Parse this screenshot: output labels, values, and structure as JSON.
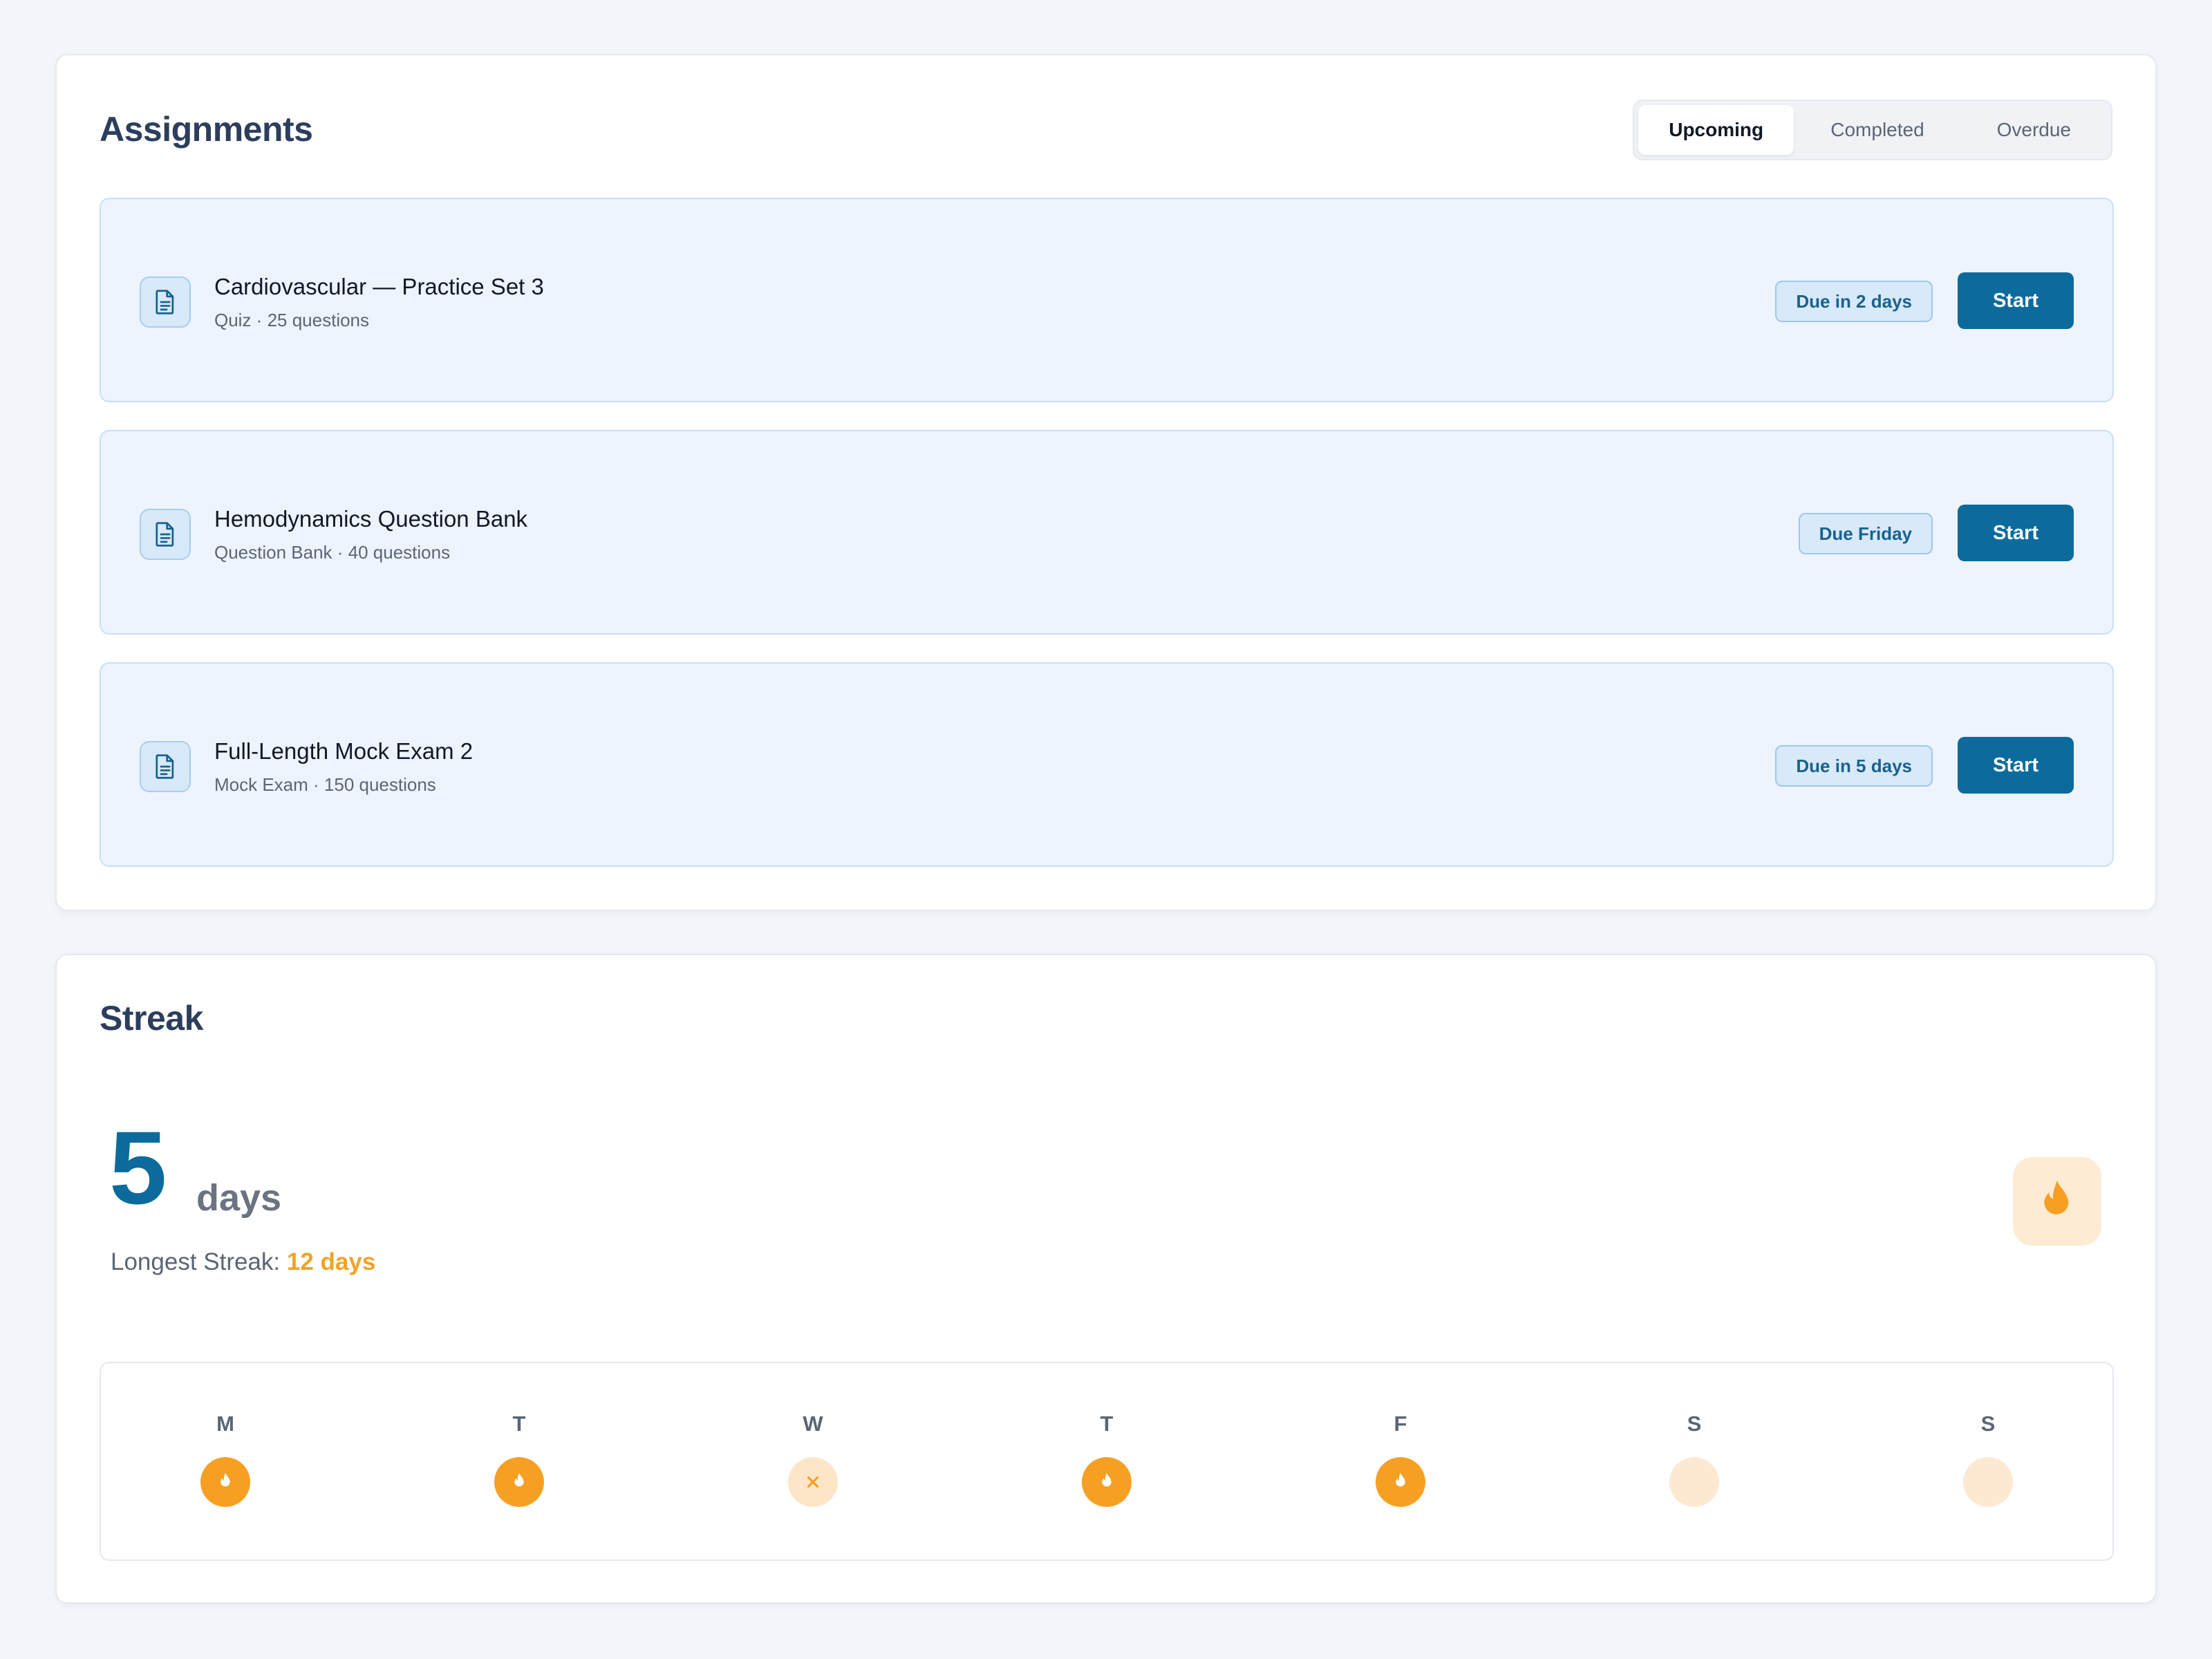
{
  "assignments": {
    "title": "Assignments",
    "tabs": [
      {
        "label": "Upcoming",
        "active": true
      },
      {
        "label": "Completed",
        "active": false
      },
      {
        "label": "Overdue",
        "active": false
      }
    ],
    "items": [
      {
        "title": "Cardiovascular — Practice Set 3",
        "subtitle": "Quiz · 25 questions",
        "due": "Due in 2 days",
        "action": "Start",
        "icon": "document-icon"
      },
      {
        "title": "Hemodynamics Question Bank",
        "subtitle": "Question Bank · 40 questions",
        "due": "Due Friday",
        "action": "Start",
        "icon": "document-icon"
      },
      {
        "title": "Full-Length Mock Exam 2",
        "subtitle": "Mock Exam · 150 questions",
        "due": "Due in 5 days",
        "action": "Start",
        "icon": "document-icon"
      }
    ]
  },
  "streak": {
    "title": "Streak",
    "count": "5",
    "unit": "days",
    "longest_label": "Longest Streak:",
    "longest_value": "12 days",
    "icon": "flame-icon",
    "week": [
      {
        "label": "M",
        "status": "done"
      },
      {
        "label": "T",
        "status": "done"
      },
      {
        "label": "W",
        "status": "missed"
      },
      {
        "label": "T",
        "status": "done"
      },
      {
        "label": "F",
        "status": "done"
      },
      {
        "label": "S",
        "status": "future"
      },
      {
        "label": "S",
        "status": "future"
      }
    ]
  },
  "colors": {
    "primary": "#0c6b9c",
    "accent": "#f6a023",
    "background": "#f2f5f9",
    "row_background": "#edf4fd"
  }
}
